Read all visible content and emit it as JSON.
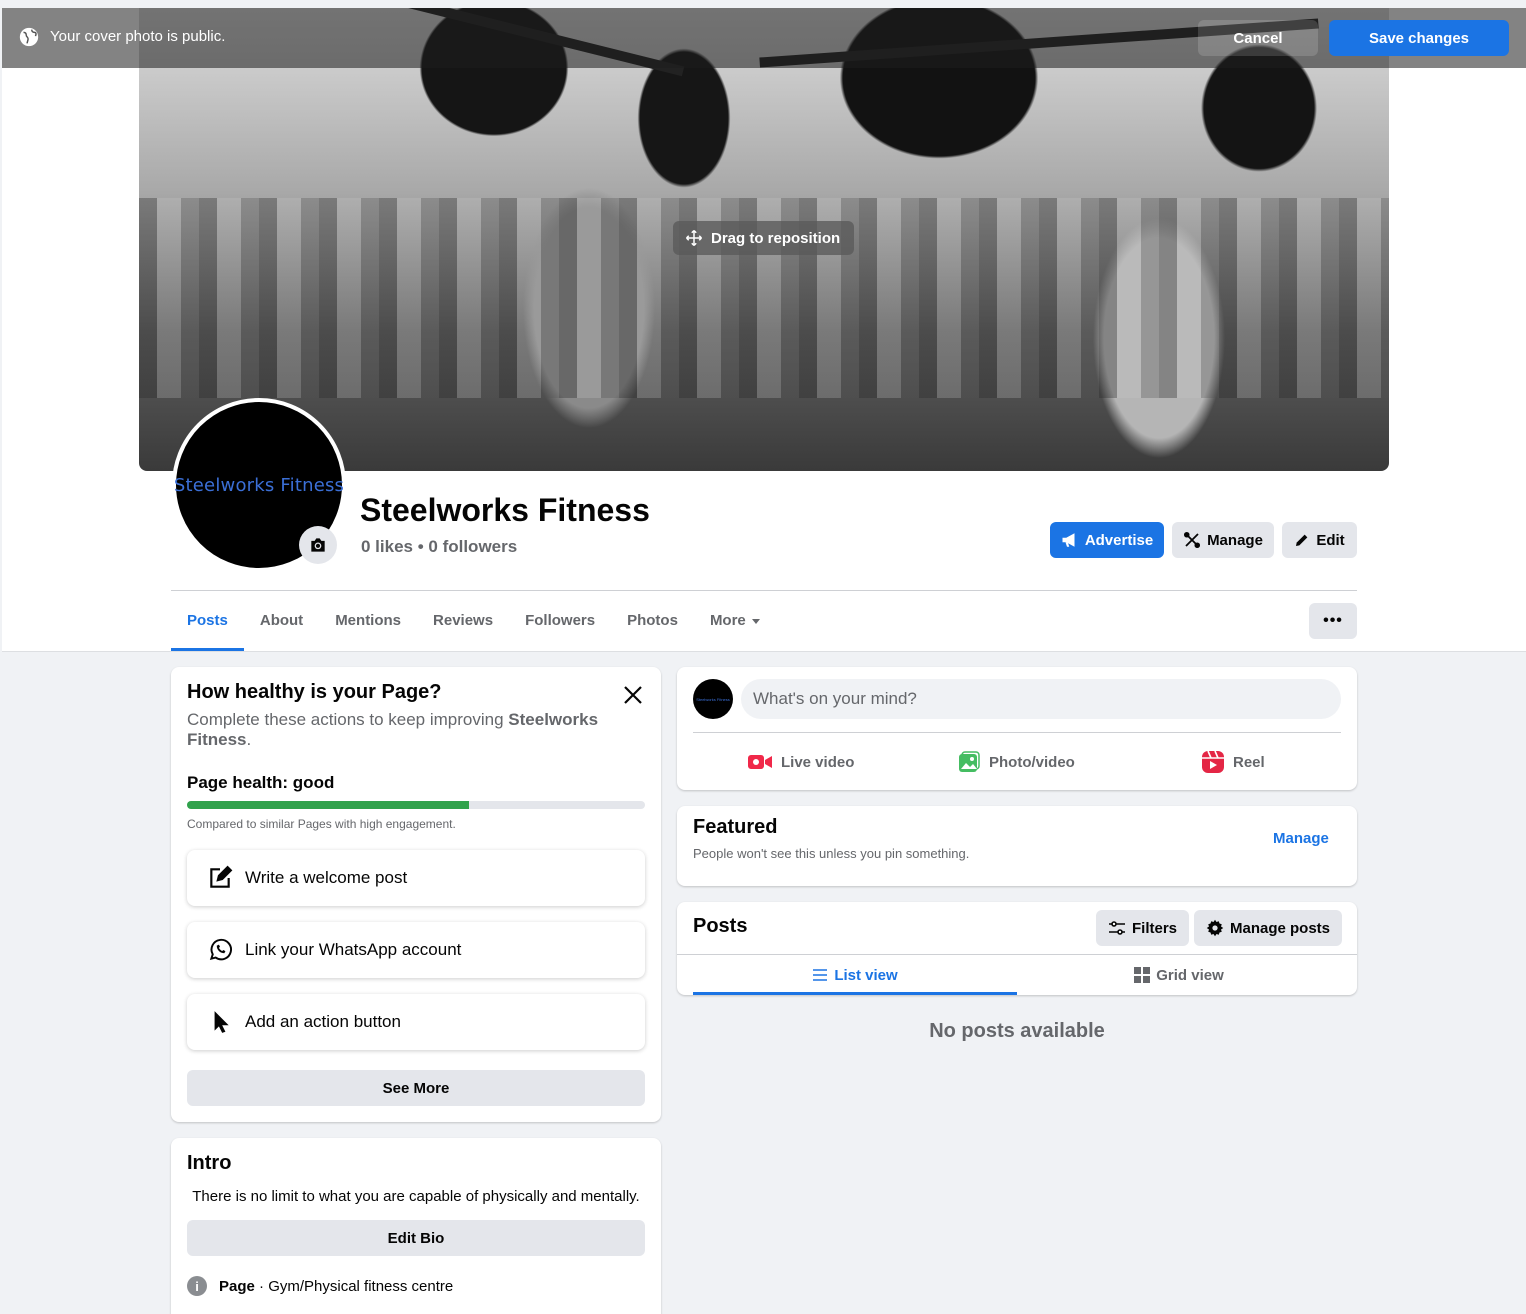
{
  "banner": {
    "message": "Your cover photo is public.",
    "cancel_label": "Cancel",
    "save_label": "Save changes"
  },
  "cover": {
    "drag_label": "Drag to reposition"
  },
  "profile": {
    "avatar_text": "Steelworks Fitness",
    "name": "Steelworks Fitness",
    "stats": "0 likes • 0 followers"
  },
  "actions": {
    "advertise": "Advertise",
    "manage": "Manage",
    "edit": "Edit"
  },
  "tabs": [
    {
      "label": "Posts",
      "active": true
    },
    {
      "label": "About"
    },
    {
      "label": "Mentions"
    },
    {
      "label": "Reviews"
    },
    {
      "label": "Followers"
    },
    {
      "label": "Photos"
    },
    {
      "label": "More"
    }
  ],
  "more_menu_label": "•••",
  "health": {
    "title": "How healthy is your Page?",
    "subtitle_prefix": "Complete these actions to keep improving ",
    "subtitle_bold": "Steelworks Fitness",
    "subtitle_suffix": ".",
    "health_label": "Page health: good",
    "health_fraction": 0.615,
    "note": "Compared to similar Pages with high engagement.",
    "tasks": [
      {
        "label": "Write a welcome post",
        "icon": "edit-icon"
      },
      {
        "label": "Link your WhatsApp account",
        "icon": "whatsapp-icon"
      },
      {
        "label": "Add an action button",
        "icon": "cursor-icon"
      }
    ],
    "see_more": "See More"
  },
  "intro": {
    "title": "Intro",
    "bio": "There is no limit to what you are capable of physically and mentally.",
    "edit_bio": "Edit Bio",
    "category_bold": "Page",
    "category_text": " · Gym/Physical fitness centre"
  },
  "composer": {
    "placeholder": "What's on your mind?",
    "live_video": "Live video",
    "photo_video": "Photo/video",
    "reel": "Reel"
  },
  "featured": {
    "title": "Featured",
    "subtitle": "People won't see this unless you pin something.",
    "manage": "Manage"
  },
  "posts": {
    "title": "Posts",
    "filters": "Filters",
    "manage_posts": "Manage posts",
    "list_view": "List view",
    "grid_view": "Grid view",
    "empty": "No posts available"
  },
  "colors": {
    "accent": "#1b74e4",
    "health_fill": "#31a24c",
    "background": "#f0f2f5"
  }
}
